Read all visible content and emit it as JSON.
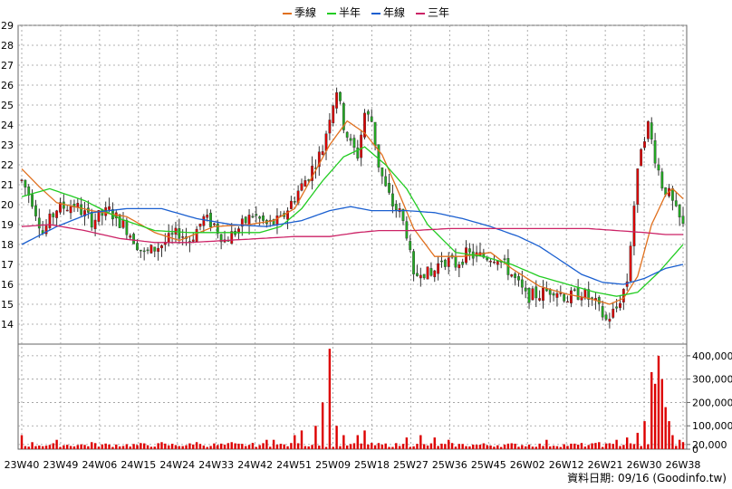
{
  "legend": [
    {
      "name": "季線",
      "color": "#e0701e"
    },
    {
      "name": "半年",
      "color": "#22cc22"
    },
    {
      "name": "年線",
      "color": "#1a5fd0"
    },
    {
      "name": "三年",
      "color": "#cc2266"
    }
  ],
  "footer": {
    "date_label": "資料日期: 09/16 (Goodinfo.tw)"
  },
  "colors": {
    "up": "#dd0000",
    "down": "#22aa22",
    "volume": "#dd0000",
    "grid": "#999999"
  },
  "chart_data": [
    {
      "type": "candlestick",
      "title": "",
      "ylim": [
        13,
        29
      ],
      "y_ticks": [
        14,
        15,
        16,
        17,
        18,
        19,
        20,
        21,
        22,
        23,
        24,
        25,
        26,
        27,
        28,
        29
      ],
      "x_ticks": [
        "23W40",
        "23W49",
        "24W06",
        "24W15",
        "24W24",
        "24W33",
        "24W42",
        "24W51",
        "25W09",
        "25W18",
        "25W27",
        "25W36",
        "25W45",
        "26W02",
        "26W12",
        "26W21",
        "26W30",
        "26W38"
      ],
      "grid": true,
      "legend_position": "top-center",
      "candle_keypoints": [
        [
          0,
          21.2
        ],
        [
          3,
          20.2
        ],
        [
          6,
          18.6
        ],
        [
          10,
          19.8
        ],
        [
          15,
          20.0
        ],
        [
          20,
          19.2
        ],
        [
          25,
          19.7
        ],
        [
          30,
          18.8
        ],
        [
          35,
          17.5
        ],
        [
          40,
          18.0
        ],
        [
          45,
          18.6
        ],
        [
          48,
          18.2
        ],
        [
          52,
          19.3
        ],
        [
          55,
          19.0
        ],
        [
          58,
          18.2
        ],
        [
          62,
          18.8
        ],
        [
          66,
          19.5
        ],
        [
          70,
          19.0
        ],
        [
          74,
          19.2
        ],
        [
          78,
          20.4
        ],
        [
          82,
          21.5
        ],
        [
          86,
          22.8
        ],
        [
          88,
          24.5
        ],
        [
          90,
          25.8
        ],
        [
          92,
          24.0
        ],
        [
          94,
          23.0
        ],
        [
          96,
          22.5
        ],
        [
          98,
          24.6
        ],
        [
          100,
          24.2
        ],
        [
          102,
          22.0
        ],
        [
          104,
          20.8
        ],
        [
          106,
          20.0
        ],
        [
          108,
          19.6
        ],
        [
          110,
          18.6
        ],
        [
          112,
          16.2
        ],
        [
          114,
          16.8
        ],
        [
          117,
          16.4
        ],
        [
          120,
          17.3
        ],
        [
          124,
          17.0
        ],
        [
          127,
          17.5
        ],
        [
          131,
          17.4
        ],
        [
          136,
          17.4
        ],
        [
          140,
          16.5
        ],
        [
          144,
          15.4
        ],
        [
          148,
          15.5
        ],
        [
          152,
          15.8
        ],
        [
          156,
          15.3
        ],
        [
          160,
          15.6
        ],
        [
          164,
          15.0
        ],
        [
          167,
          14.2
        ],
        [
          170,
          14.8
        ],
        [
          173,
          16.2
        ],
        [
          175,
          20.0
        ],
        [
          177,
          23.0
        ],
        [
          179,
          24.0
        ],
        [
          181,
          22.4
        ],
        [
          183,
          21.0
        ],
        [
          185,
          20.5
        ],
        [
          187,
          19.6
        ],
        [
          189,
          18.9
        ]
      ],
      "moving_averages": [
        {
          "name": "季線",
          "points": [
            [
              0,
              21.8
            ],
            [
              5,
              20.9
            ],
            [
              10,
              20.1
            ],
            [
              20,
              19.7
            ],
            [
              30,
              19.4
            ],
            [
              38,
              18.6
            ],
            [
              45,
              18.2
            ],
            [
              55,
              18.9
            ],
            [
              65,
              19.0
            ],
            [
              72,
              19.2
            ],
            [
              78,
              19.8
            ],
            [
              83,
              21.4
            ],
            [
              88,
              23.0
            ],
            [
              93,
              24.2
            ],
            [
              98,
              23.6
            ],
            [
              103,
              22.5
            ],
            [
              108,
              20.5
            ],
            [
              112,
              18.8
            ],
            [
              118,
              17.4
            ],
            [
              126,
              17.4
            ],
            [
              134,
              17.6
            ],
            [
              140,
              16.8
            ],
            [
              148,
              15.9
            ],
            [
              156,
              15.5
            ],
            [
              162,
              15.3
            ],
            [
              168,
              15.0
            ],
            [
              172,
              15.3
            ],
            [
              176,
              16.4
            ],
            [
              180,
              19.0
            ],
            [
              184,
              20.5
            ],
            [
              186,
              20.8
            ],
            [
              189,
              20.3
            ]
          ]
        },
        {
          "name": "半年",
          "points": [
            [
              0,
              20.4
            ],
            [
              8,
              20.8
            ],
            [
              18,
              20.2
            ],
            [
              28,
              19.3
            ],
            [
              38,
              18.7
            ],
            [
              48,
              18.6
            ],
            [
              58,
              18.6
            ],
            [
              68,
              18.6
            ],
            [
              74,
              18.9
            ],
            [
              80,
              19.8
            ],
            [
              86,
              21.2
            ],
            [
              92,
              22.4
            ],
            [
              98,
              22.9
            ],
            [
              104,
              22.0
            ],
            [
              110,
              20.8
            ],
            [
              116,
              19.0
            ],
            [
              124,
              17.6
            ],
            [
              132,
              17.4
            ],
            [
              140,
              17.0
            ],
            [
              148,
              16.4
            ],
            [
              156,
              16.0
            ],
            [
              164,
              15.6
            ],
            [
              170,
              15.4
            ],
            [
              176,
              15.6
            ],
            [
              182,
              16.6
            ],
            [
              186,
              17.4
            ],
            [
              189,
              18.0
            ]
          ]
        },
        {
          "name": "年線",
          "points": [
            [
              0,
              18.0
            ],
            [
              10,
              18.9
            ],
            [
              20,
              19.6
            ],
            [
              30,
              19.8
            ],
            [
              40,
              19.8
            ],
            [
              50,
              19.3
            ],
            [
              60,
              19.0
            ],
            [
              70,
              18.9
            ],
            [
              80,
              19.2
            ],
            [
              88,
              19.7
            ],
            [
              94,
              19.9
            ],
            [
              100,
              19.7
            ],
            [
              110,
              19.7
            ],
            [
              118,
              19.6
            ],
            [
              126,
              19.3
            ],
            [
              134,
              18.9
            ],
            [
              142,
              18.4
            ],
            [
              148,
              17.9
            ],
            [
              154,
              17.2
            ],
            [
              160,
              16.5
            ],
            [
              166,
              16.1
            ],
            [
              172,
              16.0
            ],
            [
              178,
              16.3
            ],
            [
              184,
              16.8
            ],
            [
              189,
              17.0
            ]
          ]
        },
        {
          "name": "三年",
          "points": [
            [
              0,
              18.9
            ],
            [
              8,
              19.0
            ],
            [
              18,
              18.7
            ],
            [
              28,
              18.3
            ],
            [
              38,
              18.1
            ],
            [
              48,
              18.1
            ],
            [
              58,
              18.2
            ],
            [
              68,
              18.3
            ],
            [
              78,
              18.4
            ],
            [
              88,
              18.4
            ],
            [
              96,
              18.6
            ],
            [
              102,
              18.7
            ],
            [
              112,
              18.7
            ],
            [
              122,
              18.8
            ],
            [
              132,
              18.8
            ],
            [
              142,
              18.8
            ],
            [
              152,
              18.8
            ],
            [
              162,
              18.8
            ],
            [
              170,
              18.7
            ],
            [
              178,
              18.6
            ],
            [
              184,
              18.5
            ],
            [
              189,
              18.5
            ]
          ]
        }
      ]
    },
    {
      "type": "bar",
      "title": "",
      "ylim": [
        0,
        450000
      ],
      "y_ticks": [
        "0",
        "20,000",
        "100,000",
        "200,000",
        "300,000",
        "400,000"
      ],
      "y_tick_values": [
        0,
        20000,
        100000,
        200000,
        300000,
        400000
      ],
      "spikes": [
        [
          0,
          60000
        ],
        [
          3,
          30000
        ],
        [
          10,
          40000
        ],
        [
          20,
          30000
        ],
        [
          40,
          30000
        ],
        [
          50,
          30000
        ],
        [
          60,
          30000
        ],
        [
          70,
          40000
        ],
        [
          72,
          40000
        ],
        [
          78,
          60000
        ],
        [
          80,
          80000
        ],
        [
          84,
          100000
        ],
        [
          86,
          200000
        ],
        [
          88,
          430000
        ],
        [
          90,
          100000
        ],
        [
          92,
          60000
        ],
        [
          96,
          60000
        ],
        [
          98,
          80000
        ],
        [
          110,
          50000
        ],
        [
          114,
          60000
        ],
        [
          118,
          50000
        ],
        [
          122,
          40000
        ],
        [
          150,
          40000
        ],
        [
          165,
          30000
        ],
        [
          170,
          40000
        ],
        [
          173,
          50000
        ],
        [
          176,
          70000
        ],
        [
          178,
          120000
        ],
        [
          180,
          330000
        ],
        [
          181,
          280000
        ],
        [
          182,
          400000
        ],
        [
          183,
          300000
        ],
        [
          184,
          180000
        ],
        [
          185,
          120000
        ],
        [
          186,
          60000
        ],
        [
          188,
          40000
        ],
        [
          189,
          30000
        ]
      ],
      "base_volume": 18000
    }
  ]
}
